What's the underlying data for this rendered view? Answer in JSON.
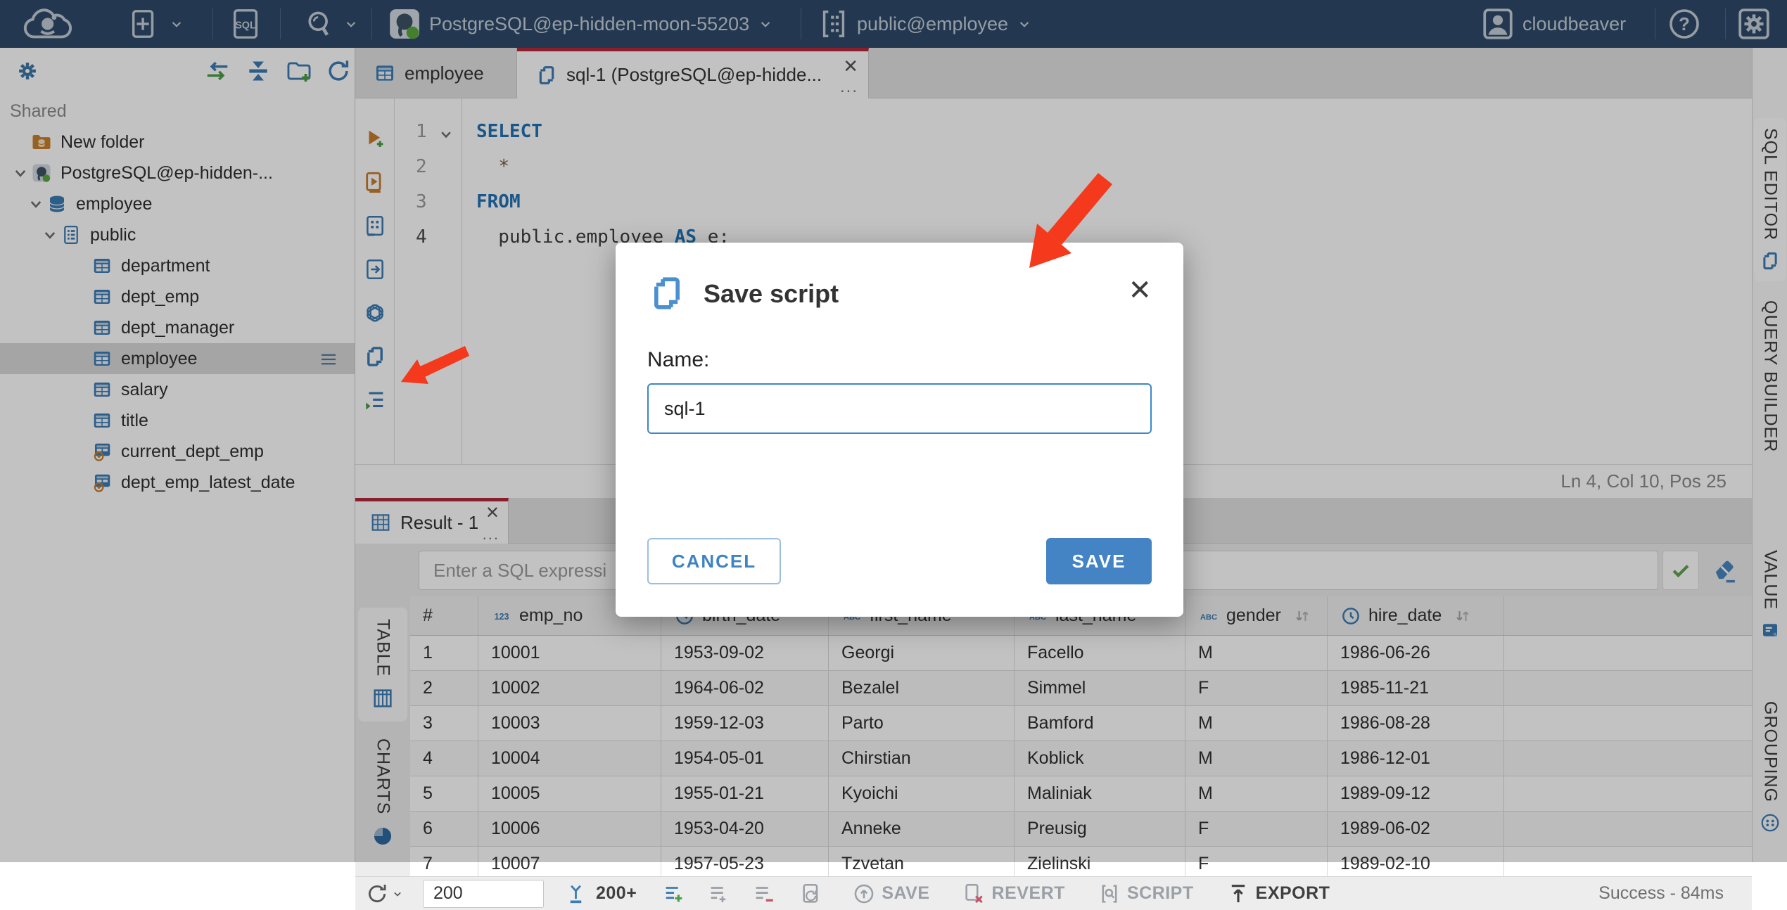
{
  "topbar": {
    "sql_badge": "SQL",
    "connection": "PostgreSQL@ep-hidden-moon-55203",
    "schema": "public@employee",
    "user": "cloudbeaver"
  },
  "sidebar": {
    "section_label": "Shared",
    "tree": [
      {
        "label": "New folder",
        "icon": "folder-db",
        "level": 1
      },
      {
        "label": "PostgreSQL@ep-hidden-...",
        "icon": "postgres",
        "level": 1,
        "chevron": true
      },
      {
        "label": "employee",
        "icon": "database",
        "level": 2,
        "chevron": true
      },
      {
        "label": "public",
        "icon": "schema",
        "level": 3,
        "chevron": true
      },
      {
        "label": "department",
        "icon": "table",
        "level": 4
      },
      {
        "label": "dept_emp",
        "icon": "table",
        "level": 4
      },
      {
        "label": "dept_manager",
        "icon": "table",
        "level": 4
      },
      {
        "label": "employee",
        "icon": "table",
        "level": 4,
        "selected": true
      },
      {
        "label": "salary",
        "icon": "table",
        "level": 4
      },
      {
        "label": "title",
        "icon": "table",
        "level": 4
      },
      {
        "label": "current_dept_emp",
        "icon": "view",
        "level": 4
      },
      {
        "label": "dept_emp_latest_date",
        "icon": "view",
        "level": 4
      }
    ]
  },
  "editor": {
    "tabs": [
      {
        "label": "employee",
        "icon": "table",
        "active": false
      },
      {
        "label": "sql-1 (PostgreSQL@ep-hidde...",
        "icon": "script",
        "active": true
      }
    ],
    "toolbar_icons": [
      "execute-new-tab",
      "execute-script",
      "query-builder",
      "execution-plan",
      "ai-assistant",
      "save-script",
      "format"
    ],
    "code_lines": [
      {
        "n": "1",
        "fold": true,
        "tokens": [
          {
            "t": "SELECT",
            "c": "kw"
          }
        ]
      },
      {
        "n": "2",
        "tokens": [
          {
            "t": "  ",
            "c": ""
          },
          {
            "t": "*",
            "c": "star"
          }
        ]
      },
      {
        "n": "3",
        "tokens": [
          {
            "t": "FROM",
            "c": "kw"
          }
        ]
      },
      {
        "n": "4",
        "cur": true,
        "tokens": [
          {
            "t": "  public.employee ",
            "c": ""
          },
          {
            "t": "AS",
            "c": "kw"
          },
          {
            "t": " e;",
            "c": ""
          }
        ]
      }
    ],
    "status": "Ln 4, Col 10, Pos 25"
  },
  "result": {
    "tab_label": "Result - 1",
    "filter_placeholder": "Enter a SQL expressi",
    "side_tabs": [
      {
        "label": "TABLE",
        "icon": "table-grid",
        "active": true
      },
      {
        "label": "CHARTS",
        "icon": "pie",
        "active": false
      }
    ],
    "table": {
      "row_header": "#",
      "columns": [
        {
          "label": "emp_no",
          "type": "123",
          "sort": false
        },
        {
          "label": "birth_date",
          "type": "clock",
          "sort": false
        },
        {
          "label": "first_name",
          "type": "ABC",
          "sort": false
        },
        {
          "label": "last_name",
          "type": "ABC",
          "sort": false
        },
        {
          "label": "gender",
          "type": "ABC",
          "sort": true
        },
        {
          "label": "hire_date",
          "type": "clock",
          "sort": true
        }
      ],
      "rows": [
        [
          "1",
          "10001",
          "1953-09-02",
          "Georgi",
          "Facello",
          "M",
          "1986-06-26"
        ],
        [
          "2",
          "10002",
          "1964-06-02",
          "Bezalel",
          "Simmel",
          "F",
          "1985-11-21"
        ],
        [
          "3",
          "10003",
          "1959-12-03",
          "Parto",
          "Bamford",
          "M",
          "1986-08-28"
        ],
        [
          "4",
          "10004",
          "1954-05-01",
          "Chirstian",
          "Koblick",
          "M",
          "1986-12-01"
        ],
        [
          "5",
          "10005",
          "1955-01-21",
          "Kyoichi",
          "Maliniak",
          "M",
          "1989-09-12"
        ],
        [
          "6",
          "10006",
          "1953-04-20",
          "Anneke",
          "Preusig",
          "F",
          "1989-06-02"
        ],
        [
          "7",
          "10007",
          "1957-05-23",
          "Tzvetan",
          "Zielinski",
          "F",
          "1989-02-10"
        ]
      ]
    },
    "toolbar": {
      "rows_value": "200",
      "fetch_label": "200+",
      "save_label": "SAVE",
      "revert_label": "REVERT",
      "script_label": "SCRIPT",
      "export_label": "EXPORT"
    },
    "status": "Success - 84ms"
  },
  "rightbar": {
    "tabs": [
      {
        "label": "SQL EDITOR",
        "icon": "script",
        "active": true
      },
      {
        "label": "QUERY BUILDER",
        "icon": "",
        "active": false
      },
      {
        "label": "VALUE",
        "icon": "value",
        "active": false
      },
      {
        "label": "GROUPING",
        "icon": "grouping",
        "active": false
      }
    ]
  },
  "modal": {
    "title": "Save script",
    "name_label": "Name:",
    "input_value": "sql-1",
    "cancel_label": "CANCEL",
    "save_label": "SAVE"
  },
  "colors": {
    "accent_blue": "#3c7cb4",
    "tab_red": "#b5293a",
    "annotation_arrow": "#f4391c",
    "status_green": "#59a83a",
    "icon_orange": "#c87d2e"
  }
}
